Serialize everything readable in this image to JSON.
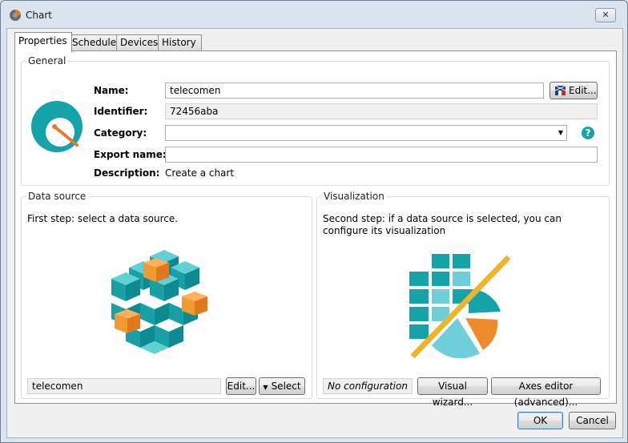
{
  "window": {
    "title": "Chart",
    "close_glyph": "✕"
  },
  "tabs": [
    {
      "label": "Properties",
      "active": true
    },
    {
      "label": "Schedule",
      "active": false
    },
    {
      "label": "Devices",
      "active": false
    },
    {
      "label": "History",
      "active": false
    }
  ],
  "general": {
    "title": "General",
    "name_label": "Name:",
    "name_value": "telecomen",
    "edit_label": "Edit...",
    "identifier_label": "Identifier:",
    "identifier_value": "72456aba",
    "category_label": "Category:",
    "category_value": "",
    "export_label": "Export name:",
    "export_value": "",
    "description_label": "Description:",
    "description_value": "Create a chart",
    "help_glyph": "?"
  },
  "data_source": {
    "title": "Data source",
    "instruction": "First step: select a data source.",
    "current": "telecomen",
    "edit_label": "Edit...",
    "select_label": "Select",
    "select_arrow": "▼"
  },
  "visualization": {
    "title": "Visualization",
    "instruction": "Second step: if a data source is selected, you can configure its visualization",
    "status": "No configuration",
    "wizard_label": "Visual wizard...",
    "axes_label": "Axes editor (advanced)..."
  },
  "footer": {
    "ok_label": "OK",
    "cancel_label": "Cancel"
  },
  "colors": {
    "teal": "#13a3a8",
    "orange": "#f08a2c",
    "gold": "#f0b42a",
    "light_teal": "#6fcfd8"
  }
}
